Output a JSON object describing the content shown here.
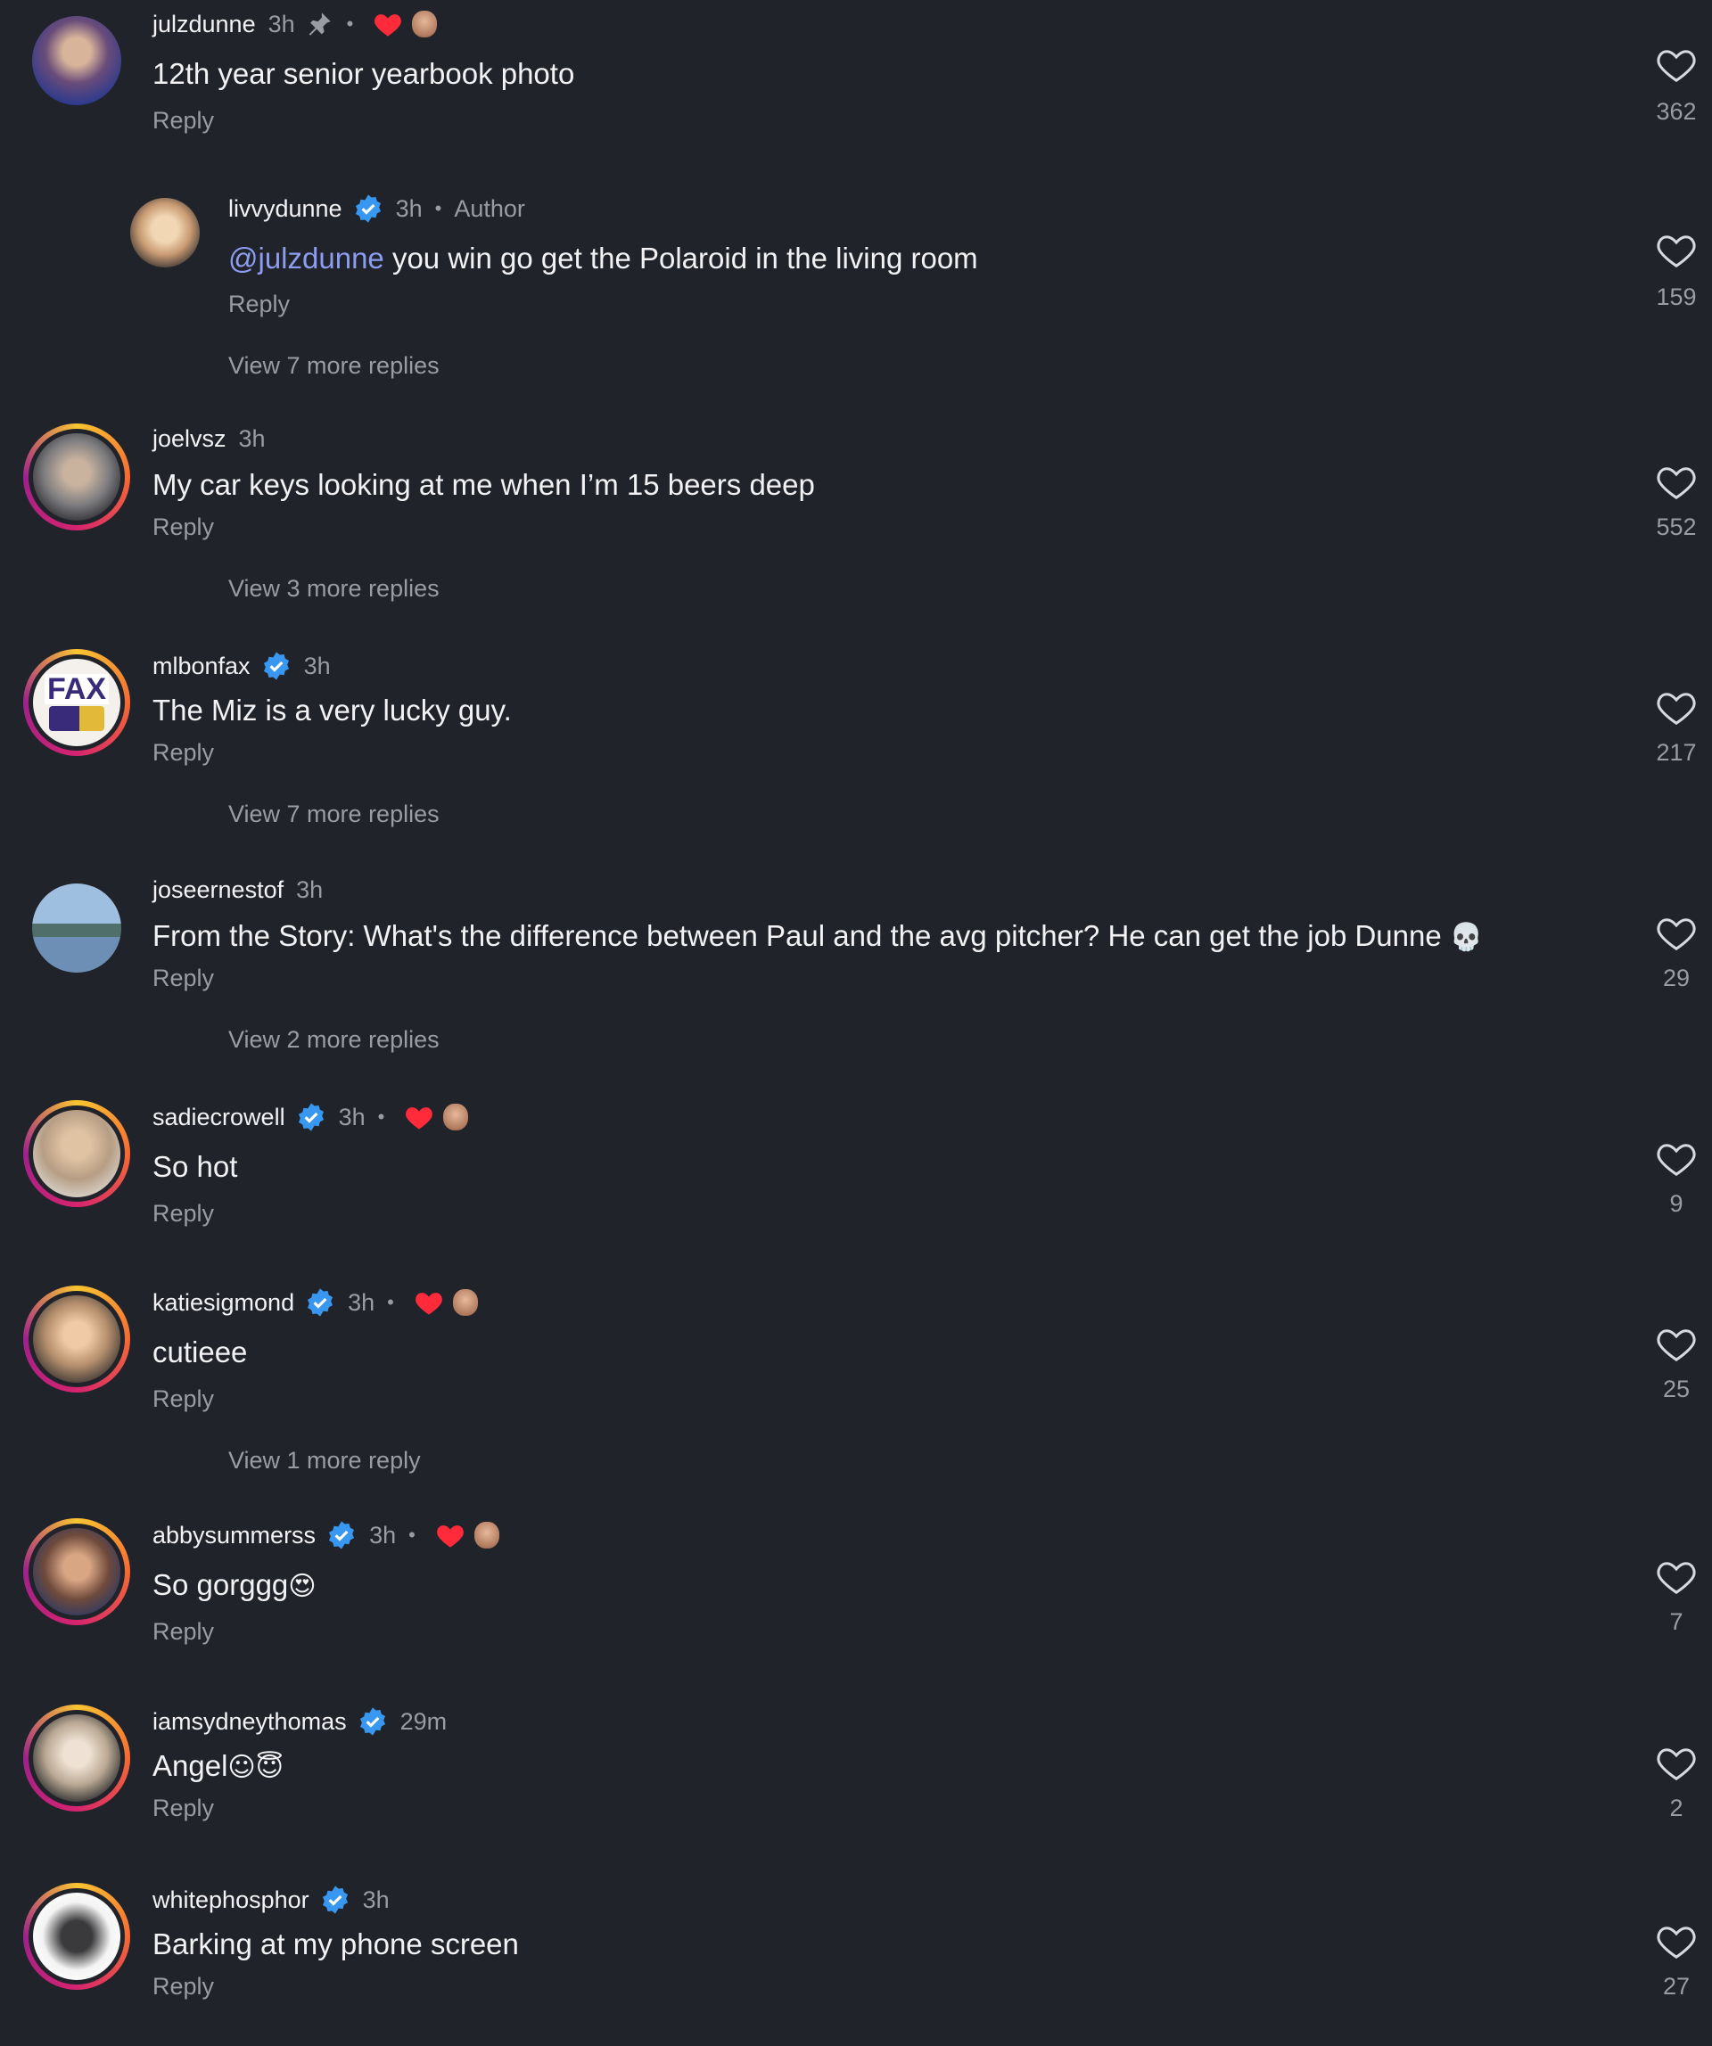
{
  "comments": [
    {
      "user": "julzdunne",
      "time": "3h",
      "pinned": true,
      "creator_liked": true,
      "text": "12th year senior yearbook photo",
      "reply": "Reply",
      "likes": "362"
    },
    {
      "user": "livvydunne",
      "verified": true,
      "time": "3h",
      "author": "Author",
      "mention": "@julzdunne",
      "text": " you win go get the Polaroid in the living room",
      "reply": "Reply",
      "likes": "159",
      "more": "View 7 more replies"
    },
    {
      "user": "joelvsz",
      "time": "3h",
      "text": "My car keys looking at me when I’m 15 beers deep",
      "reply": "Reply",
      "likes": "552",
      "more": "View 3 more replies"
    },
    {
      "user": "mlbonfax",
      "verified": true,
      "time": "3h",
      "text": "The Miz is a very lucky guy.",
      "reply": "Reply",
      "likes": "217",
      "more": "View 7 more replies",
      "avatar_text": "FAX"
    },
    {
      "user": "joseernestof",
      "time": "3h",
      "text": "From the Story: What's the difference between Paul and the avg pitcher? He can get the job Dunne",
      "emoji": "💀",
      "reply": "Reply",
      "likes": "29",
      "more": "View 2 more replies"
    },
    {
      "user": "sadiecrowell",
      "verified": true,
      "time": "3h",
      "creator_liked": true,
      "text": "So hot",
      "reply": "Reply",
      "likes": "9"
    },
    {
      "user": "katiesigmond",
      "verified": true,
      "time": "3h",
      "creator_liked": true,
      "text": "cutieee",
      "reply": "Reply",
      "likes": "25",
      "more": "View 1 more reply"
    },
    {
      "user": "abbysummerss",
      "verified": true,
      "time": "3h",
      "creator_liked": true,
      "text": "So gorggg",
      "emoji": "😍",
      "reply": "Reply",
      "likes": "7"
    },
    {
      "user": "iamsydneythomas",
      "verified": true,
      "time": "29m",
      "text": "Angel",
      "emoji": "☺😇",
      "reply": "Reply",
      "likes": "2"
    },
    {
      "user": "whitephosphor",
      "verified": true,
      "time": "3h",
      "text": "Barking at my phone screen",
      "reply": "Reply",
      "likes": "27"
    }
  ],
  "separator": "•",
  "colors": {
    "background": "#21232a",
    "text": "#f2f2f4",
    "muted": "#9a9ca4",
    "verified": "#3897f0",
    "mention": "#8c9cf0",
    "heart_red": "#ff2b3a"
  },
  "icons": {
    "like": "heart-outline-icon",
    "verified": "verified-badge-icon",
    "pinned": "pin-icon",
    "creator_like": "red-heart-icon"
  }
}
